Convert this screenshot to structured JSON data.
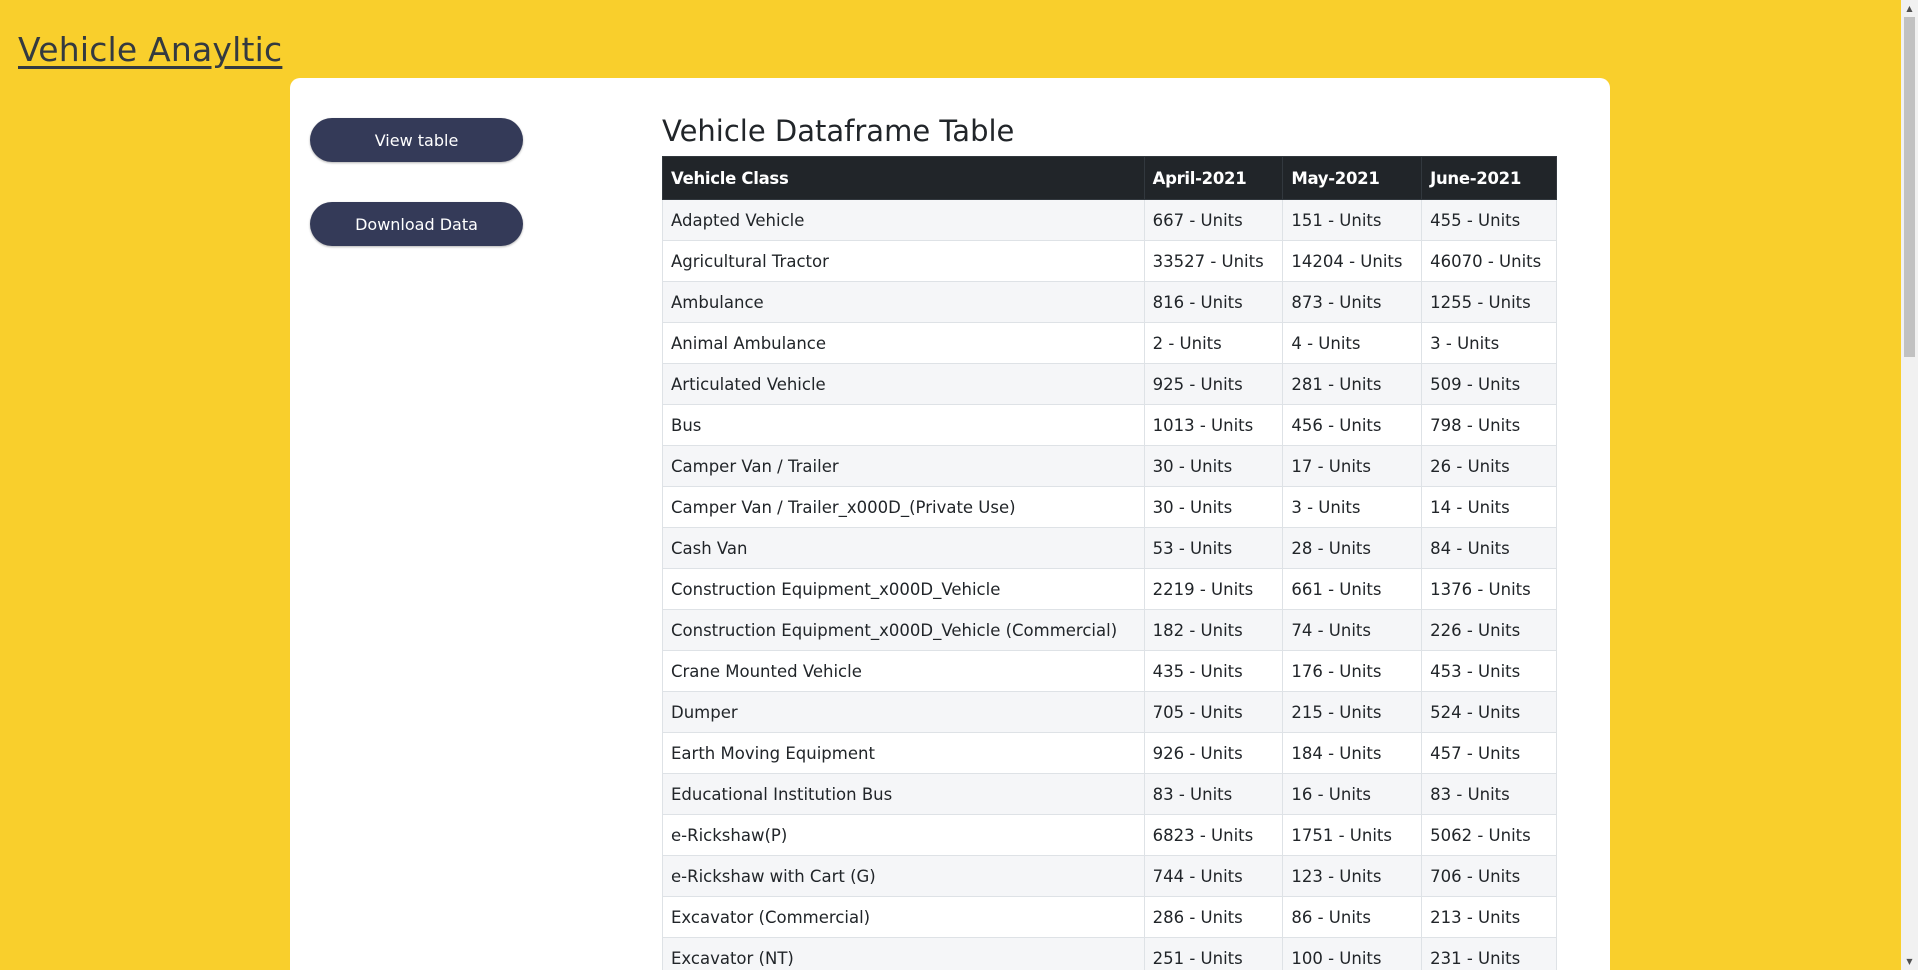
{
  "header": {
    "title": "Vehicle Anayltic"
  },
  "sidebar": {
    "view_table_label": "View table",
    "download_label": "Download Data"
  },
  "table": {
    "title": "Vehicle Dataframe Table",
    "columns": [
      "Vehicle Class",
      "April-2021",
      "May-2021",
      "June-2021"
    ],
    "rows": [
      [
        "Adapted Vehicle",
        "667 - Units",
        "151 - Units",
        "455 - Units"
      ],
      [
        "Agricultural Tractor",
        "33527 - Units",
        "14204 - Units",
        "46070 - Units"
      ],
      [
        "Ambulance",
        "816 - Units",
        "873 - Units",
        "1255 - Units"
      ],
      [
        "Animal Ambulance",
        "2 - Units",
        "4 - Units",
        "3 - Units"
      ],
      [
        "Articulated Vehicle",
        "925 - Units",
        "281 - Units",
        "509 - Units"
      ],
      [
        "Bus",
        "1013 - Units",
        "456 - Units",
        "798 - Units"
      ],
      [
        "Camper Van / Trailer",
        "30 - Units",
        "17 - Units",
        "26 - Units"
      ],
      [
        "Camper Van / Trailer_x000D_(Private Use)",
        "30 - Units",
        "3 - Units",
        "14 - Units"
      ],
      [
        "Cash Van",
        "53 - Units",
        "28 - Units",
        "84 - Units"
      ],
      [
        "Construction Equipment_x000D_Vehicle",
        "2219 - Units",
        "661 - Units",
        "1376 - Units"
      ],
      [
        "Construction Equipment_x000D_Vehicle (Commercial)",
        "182 - Units",
        "74 - Units",
        "226 - Units"
      ],
      [
        "Crane Mounted Vehicle",
        "435 - Units",
        "176 - Units",
        "453 - Units"
      ],
      [
        "Dumper",
        "705 - Units",
        "215 - Units",
        "524 - Units"
      ],
      [
        "Earth Moving Equipment",
        "926 - Units",
        "184 - Units",
        "457 - Units"
      ],
      [
        "Educational Institution Bus",
        "83 - Units",
        "16 - Units",
        "83 - Units"
      ],
      [
        "e-Rickshaw(P)",
        "6823 - Units",
        "1751 - Units",
        "5062 - Units"
      ],
      [
        "e-Rickshaw with Cart (G)",
        "744 - Units",
        "123 - Units",
        "706 - Units"
      ],
      [
        "Excavator (Commercial)",
        "286 - Units",
        "86 - Units",
        "213 - Units"
      ],
      [
        "Excavator (NT)",
        "251 - Units",
        "100 - Units",
        "231 - Units"
      ]
    ]
  },
  "icons": {
    "scroll_up": "▲",
    "scroll_down": "▼"
  }
}
